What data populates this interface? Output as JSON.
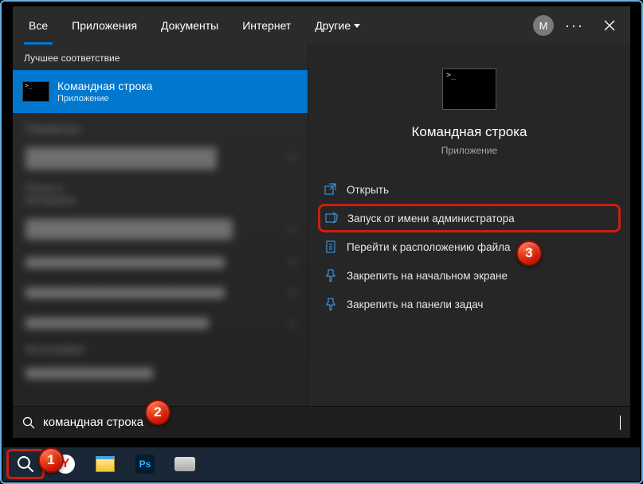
{
  "header": {
    "tabs": [
      "Все",
      "Приложения",
      "Документы",
      "Интернет",
      "Другие"
    ],
    "avatar_letter": "M"
  },
  "left": {
    "best_match": "Лучшее соответствие",
    "result_title": "Командная строка",
    "result_sub": "Приложение"
  },
  "right": {
    "title": "Командная строка",
    "sub": "Приложение",
    "actions": {
      "open": "Открыть",
      "run_admin": "Запуск от имени администратора",
      "open_location": "Перейти к расположению файла",
      "pin_start": "Закрепить на начальном экране",
      "pin_taskbar": "Закрепить на панели задач"
    }
  },
  "search": {
    "query": "командная строка"
  },
  "callouts": {
    "c1": "1",
    "c2": "2",
    "c3": "3"
  }
}
